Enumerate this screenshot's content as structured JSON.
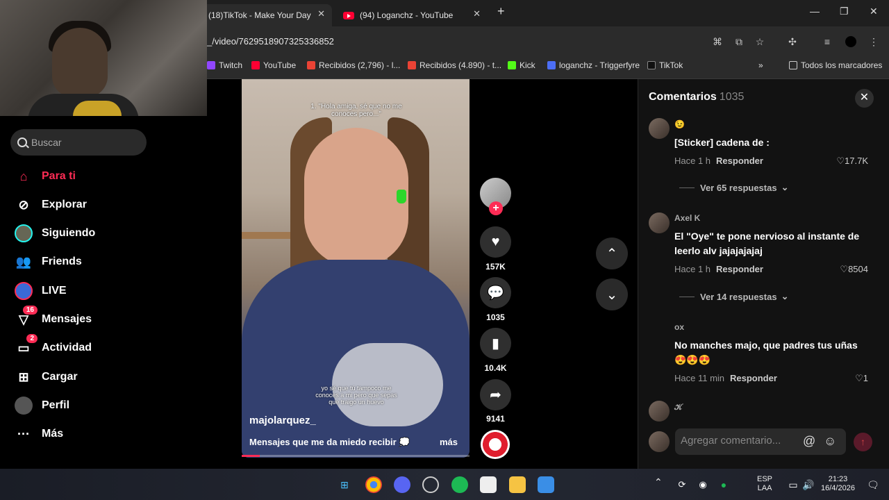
{
  "browser": {
    "tabs": [
      {
        "title": "(18)TikTok - Make Your Day",
        "active": true
      },
      {
        "title": "(94) Loganchz - YouTube",
        "active": false
      }
    ],
    "url": "_/video/7629518907325336852",
    "bookmarks": [
      "Twitch",
      "YouTube",
      "Recibidos (2,796) - l...",
      "Recibidos (4.890) - t...",
      "Kick",
      "loganchz - Triggerfyre",
      "TikTok"
    ],
    "all_bookmarks": "Todos los marcadores"
  },
  "sidebar": {
    "search_placeholder": "Buscar",
    "items": [
      {
        "label": "Para ti",
        "icon": "home-icon",
        "active": true
      },
      {
        "label": "Explorar",
        "icon": "compass-icon"
      },
      {
        "label": "Siguiendo",
        "icon": "following-avatar-icon"
      },
      {
        "label": "Friends",
        "icon": "friends-icon"
      },
      {
        "label": "LIVE",
        "icon": "live-icon"
      },
      {
        "label": "Mensajes",
        "icon": "messages-icon",
        "badge": "16"
      },
      {
        "label": "Actividad",
        "icon": "activity-icon",
        "badge": "2"
      },
      {
        "label": "Cargar",
        "icon": "upload-icon"
      },
      {
        "label": "Perfil",
        "icon": "profile-avatar-icon"
      },
      {
        "label": "Más",
        "icon": "more-icon"
      }
    ]
  },
  "video": {
    "overlay_top": "1. \"Hola amiga, sé que no me conoces pero...\"",
    "overlay_bottom": "yo sé que tú tampoco me conoces a mi pero que sepas que traigo un huevo",
    "author": "majolarquez_",
    "caption": "Mensajes que me da miedo recibir 💭",
    "more": "más",
    "progress": 0.08
  },
  "actions": {
    "likes": "157K",
    "comments": "1035",
    "saves": "10.4K",
    "shares": "9141"
  },
  "comments": {
    "title": "Comentarios",
    "count": "1035",
    "items": [
      {
        "user": "😉",
        "text": "[Sticker] cadena de :",
        "time": "Hace 1 h",
        "reply": "Responder",
        "likes": "17.7K",
        "replies": "Ver 65 respuestas"
      },
      {
        "user": "Axel K",
        "text": "El \"Oye\" te pone nervioso al instante de leerlo alv jajajajajaj",
        "time": "Hace 1 h",
        "reply": "Responder",
        "likes": "8504",
        "replies": "Ver 14 respuestas"
      },
      {
        "user": "ox",
        "text": "No manches majo, que padres tus uñas 😍😍😍",
        "time": "Hace 11 min",
        "reply": "Responder",
        "likes": "1"
      },
      {
        "user": "𝒦"
      }
    ],
    "input_placeholder": "Agregar comentario..."
  },
  "taskbar": {
    "lang1": "ESP",
    "lang2": "LAA",
    "time": "21:23",
    "date": "16/4/2026"
  },
  "colors": {
    "accent": "#fe2c55",
    "panel": "#121212",
    "chrome": "#2b2b2b"
  }
}
